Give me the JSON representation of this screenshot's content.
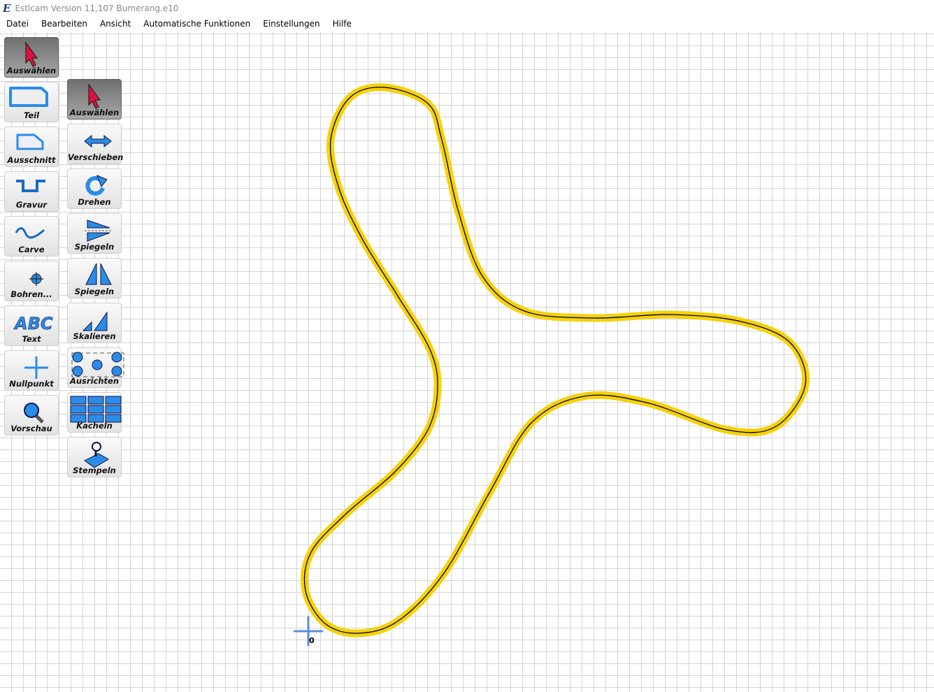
{
  "title": "Estlcam Version 11,107 Bumerang.e10",
  "menu": [
    "Datei",
    "Bearbeiten",
    "Ansicht",
    "Automatische Funktionen",
    "Einstellungen",
    "Hilfe"
  ],
  "toolbar_left": [
    {
      "label": "Auswählen",
      "icon": "pointer-icon",
      "selected": true
    },
    {
      "label": "Teil",
      "icon": "part-icon"
    },
    {
      "label": "Ausschnitt",
      "icon": "pocket-icon"
    },
    {
      "label": "Gravur",
      "icon": "engrave-icon"
    },
    {
      "label": "Carve",
      "icon": "carve-icon"
    },
    {
      "label": "Bohren...",
      "icon": "drill-icon"
    },
    {
      "label": "Text",
      "icon": "text-icon"
    },
    {
      "label": "Nullpunkt",
      "icon": "origin-icon"
    },
    {
      "label": "Vorschau",
      "icon": "magnifier-icon"
    }
  ],
  "toolbar_right": [
    {
      "label": "Auswählen",
      "icon": "pointer-icon",
      "selected": true
    },
    {
      "label": "Verschieben",
      "icon": "move-arrows-icon"
    },
    {
      "label": "Drehen",
      "icon": "rotate-icon"
    },
    {
      "label": "Spiegeln",
      "icon": "mirror-horizontal-icon"
    },
    {
      "label": "Spiegeln",
      "icon": "mirror-vertical-icon"
    },
    {
      "label": "Skalieren",
      "icon": "scale-icon"
    },
    {
      "label": "Ausrichten",
      "icon": "align-icon"
    },
    {
      "label": "Kacheln",
      "icon": "tile-icon"
    },
    {
      "label": "Stempeln",
      "icon": "stamp-icon"
    }
  ],
  "origin_label": "0",
  "colors": {
    "path": "#f5d10a",
    "accent": "#2a8ce8",
    "pointer": "#e0103c"
  }
}
